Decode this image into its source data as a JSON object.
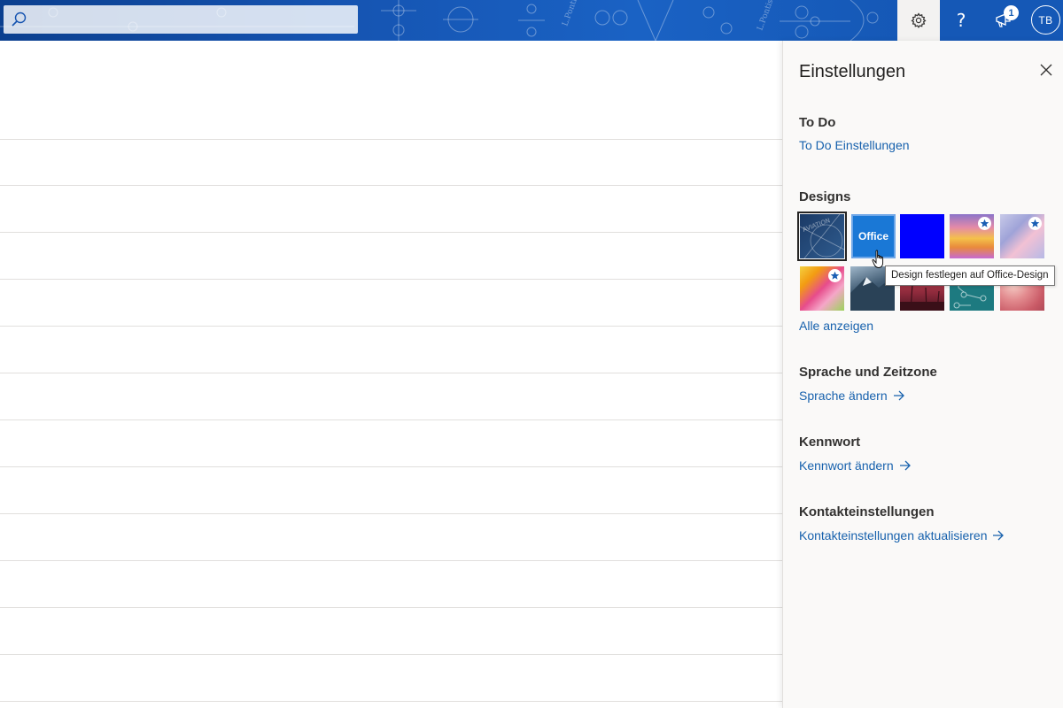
{
  "header": {
    "search_placeholder": "",
    "notification_count": "1",
    "help_glyph": "?",
    "avatar_initials": "TB",
    "icons": [
      "search-icon",
      "gear-icon",
      "help-icon",
      "notification-icon"
    ],
    "colors": {
      "bar_blue": "#1553b0",
      "gear_bg": "#f3f2f1"
    }
  },
  "settings": {
    "title": "Einstellungen",
    "sections": {
      "todo": {
        "heading": "To Do",
        "link": "To Do Einstellungen"
      },
      "designs": {
        "heading": "Designs",
        "show_all": "Alle anzeigen",
        "office_tile_label": "Office",
        "tooltip": "Design festlegen auf Office-Design",
        "tiles": [
          "blueprint",
          "office",
          "blue",
          "rainbow",
          "pastel",
          "colorful",
          "mountain",
          "palms",
          "circuit",
          "bokeh"
        ]
      },
      "language": {
        "heading": "Sprache und Zeitzone",
        "link": "Sprache ändern"
      },
      "password": {
        "heading": "Kennwort",
        "link": "Kennwort ändern"
      },
      "contact": {
        "heading": "Kontakteinstellungen",
        "link": "Kontakteinstellungen aktualisieren"
      }
    },
    "colors": {
      "link": "#1761ad",
      "heading": "#323130",
      "panel_bg": "#faf9f8"
    }
  }
}
